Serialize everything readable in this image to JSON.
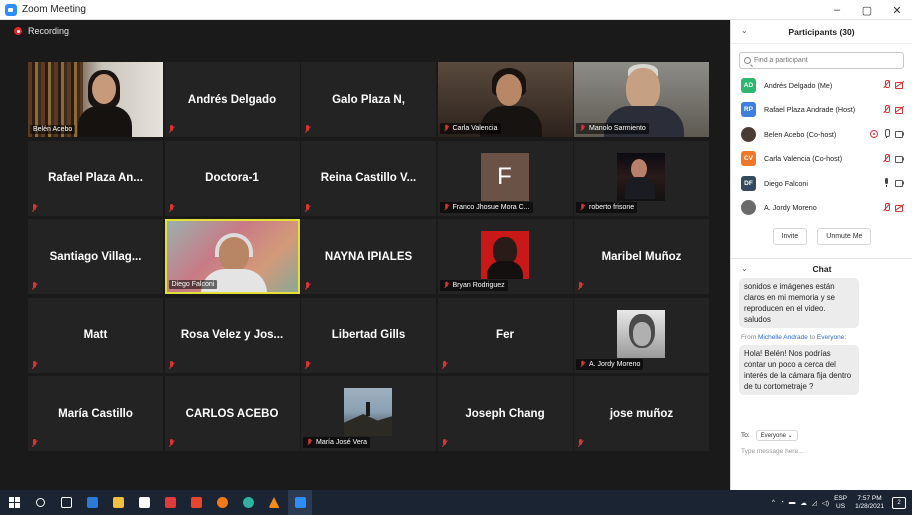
{
  "window": {
    "title": "Zoom Meeting"
  },
  "meeting": {
    "recording_label": "Recording"
  },
  "tiles": [
    {
      "name": "Belén Acebo",
      "kind": "video",
      "video": "belen"
    },
    {
      "name": "Andrés Delgado",
      "kind": "name"
    },
    {
      "name": "Galo Plaza N,",
      "kind": "name"
    },
    {
      "name": "Carla Valencia",
      "kind": "video",
      "video": "carla"
    },
    {
      "name": "Manolo Sarmiento",
      "kind": "video",
      "video": "manolo"
    },
    {
      "name": "Rafael Plaza An...",
      "kind": "name"
    },
    {
      "name": "Doctora-1",
      "kind": "name"
    },
    {
      "name": "Reina Castillo V...",
      "kind": "name"
    },
    {
      "name": "Franco Jhosue Mora C...",
      "kind": "avatar",
      "letter": "F"
    },
    {
      "name": "roberto frisone",
      "kind": "thumb",
      "thumb": "roberto"
    },
    {
      "name": "Santiago Villag...",
      "kind": "name"
    },
    {
      "name": "Diego Falconi",
      "kind": "video",
      "video": "diego",
      "speaking": true
    },
    {
      "name": "NAYNA IPIALES",
      "kind": "name"
    },
    {
      "name": "Bryan Rodriguez",
      "kind": "thumb",
      "thumb": "bryan"
    },
    {
      "name": "Maribel Muñoz",
      "kind": "name"
    },
    {
      "name": "Matt",
      "kind": "name"
    },
    {
      "name": "Rosa Velez y Jos...",
      "kind": "name"
    },
    {
      "name": "Libertad Gills",
      "kind": "name"
    },
    {
      "name": "Fer",
      "kind": "name"
    },
    {
      "name": "A. Jordy Moreno",
      "kind": "thumb",
      "thumb": "jordy"
    },
    {
      "name": "María Castillo",
      "kind": "name"
    },
    {
      "name": "CARLOS ACEBO",
      "kind": "name"
    },
    {
      "name": "María José Vera",
      "kind": "thumb",
      "thumb": "maria"
    },
    {
      "name": "Joseph Chang",
      "kind": "name"
    },
    {
      "name": "jose muñoz",
      "kind": "name"
    }
  ],
  "participants_panel": {
    "title": "Participants (30)",
    "search_placeholder": "Find a participant",
    "items": [
      {
        "initials": "AD",
        "color": "#2fb670",
        "name": "Andrés Delgado (Me)",
        "icons": [
          "mic-off",
          "cam-off"
        ]
      },
      {
        "initials": "RP",
        "color": "#3f7ee0",
        "name": "Rafael Plaza Andrade (Host)",
        "icons": [
          "mic-off",
          "cam-off"
        ]
      },
      {
        "initials": "",
        "color": "#4a3b34",
        "name": "Belen Acebo (Co-host)",
        "icons": [
          "rec-ring",
          "mic-on",
          "cam-on"
        ]
      },
      {
        "initials": "CV",
        "color": "#f0762a",
        "name": "Carla Valencia (Co-host)",
        "icons": [
          "mic-off",
          "cam-on"
        ]
      },
      {
        "initials": "DF",
        "color": "#34495e",
        "name": "Diego Falconi",
        "icons": [
          "mic-on-dark",
          "cam-on"
        ]
      },
      {
        "initials": "",
        "color": "#6a6a6a",
        "name": "A. Jordy Moreno",
        "icons": [
          "mic-off",
          "cam-off"
        ]
      }
    ],
    "invite_label": "Invite",
    "unmute_label": "Unmute Me"
  },
  "chat_panel": {
    "title": "Chat",
    "message1": "sonidos e imágenes están claros en mi memoria y se reproducen en el video. saludos",
    "from_label": "From",
    "from_name": "Michelle Andrade",
    "to_label": "to",
    "to_name": "Everyone:",
    "message2": "Hola! Belén! Nos podrías contar un poco a cerca del interés de la cámara fija dentro de tu cortometraje ?",
    "to_prefix": "To:",
    "to_select": "Everyone ⌄",
    "input_placeholder": "Type message here..."
  },
  "taskbar": {
    "lang_top": "ESP",
    "lang_bottom": "US",
    "time": "7:57 PM",
    "date": "1/28/2021",
    "notif": "2"
  }
}
